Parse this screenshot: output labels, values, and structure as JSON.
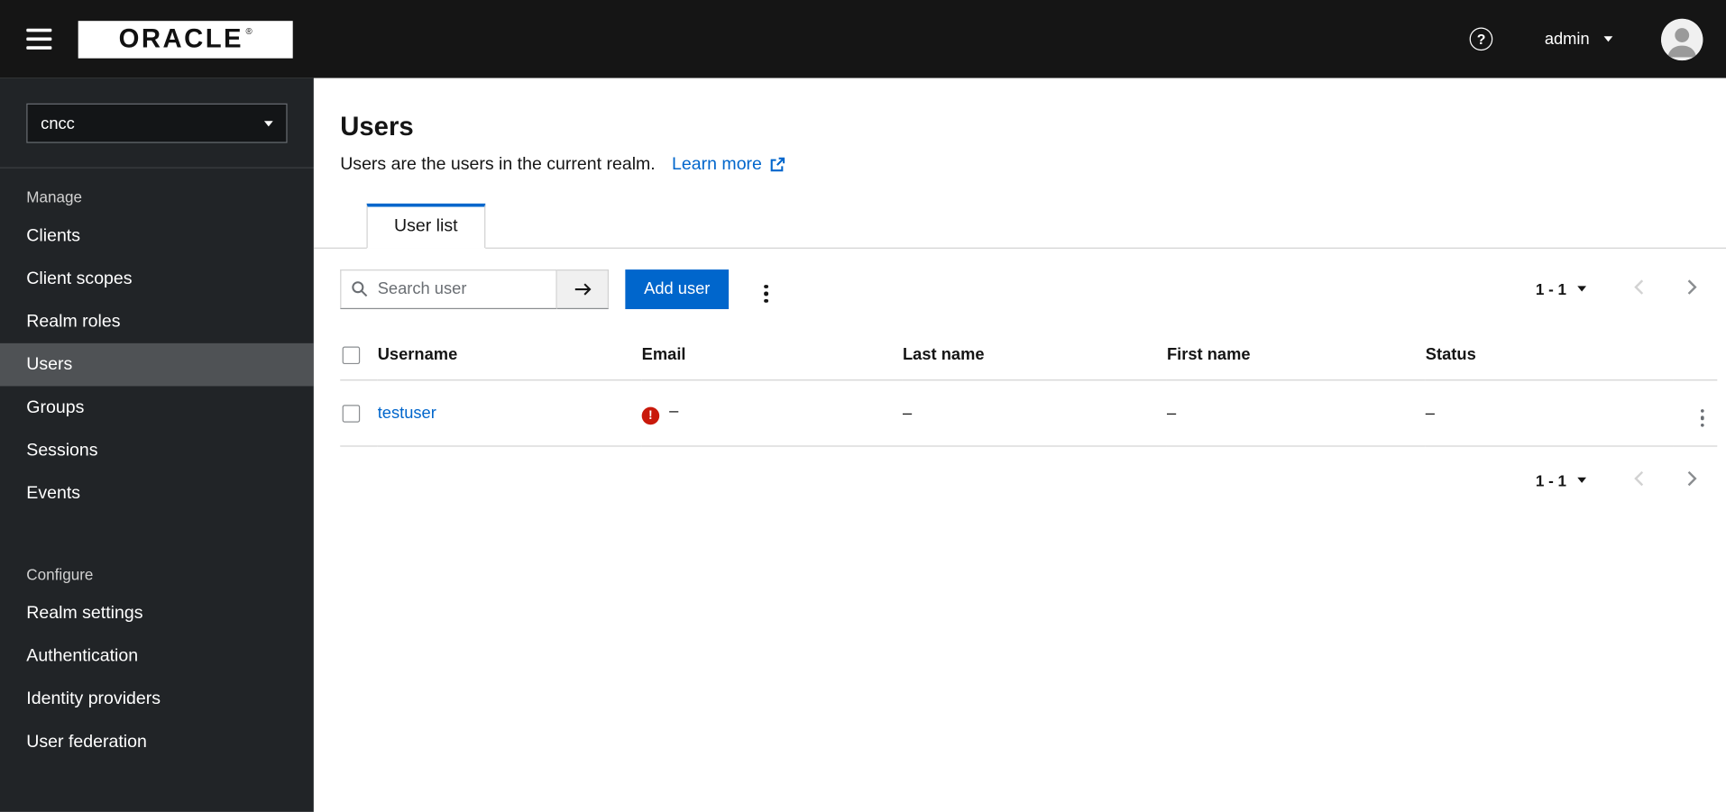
{
  "topbar": {
    "brand": "ORACLE",
    "brand_registered": "®",
    "username": "admin",
    "help_glyph": "?"
  },
  "sidebar": {
    "realm": "cncc",
    "sections": [
      {
        "label": "Manage",
        "items": [
          {
            "label": "Clients"
          },
          {
            "label": "Client scopes"
          },
          {
            "label": "Realm roles"
          },
          {
            "label": "Users",
            "current": true
          },
          {
            "label": "Groups"
          },
          {
            "label": "Sessions"
          },
          {
            "label": "Events"
          }
        ]
      },
      {
        "label": "Configure",
        "items": [
          {
            "label": "Realm settings"
          },
          {
            "label": "Authentication"
          },
          {
            "label": "Identity providers"
          },
          {
            "label": "User federation"
          }
        ]
      }
    ]
  },
  "main": {
    "title": "Users",
    "description": "Users are the users in the current realm.",
    "learn_more_label": "Learn more",
    "tab": "User list",
    "toolbar": {
      "search_placeholder": "Search user",
      "add_user": "Add user",
      "pagination": "1 - 1"
    },
    "table": {
      "columns": [
        "Username",
        "Email",
        "Last name",
        "First name",
        "Status"
      ],
      "row": {
        "username": "testuser",
        "email": "–",
        "last_name": "–",
        "first_name": "–",
        "status": "–",
        "email_error": true
      }
    },
    "pagination_bottom": "1 - 1"
  },
  "colors": {
    "primary": "#0066cc",
    "link": "#0066cc",
    "error": "#c9190b",
    "topbar_bg": "#151515",
    "sidebar_bg": "#212427",
    "sidebar_current_bg": "#4f5255",
    "border": "#d2d2d2"
  }
}
